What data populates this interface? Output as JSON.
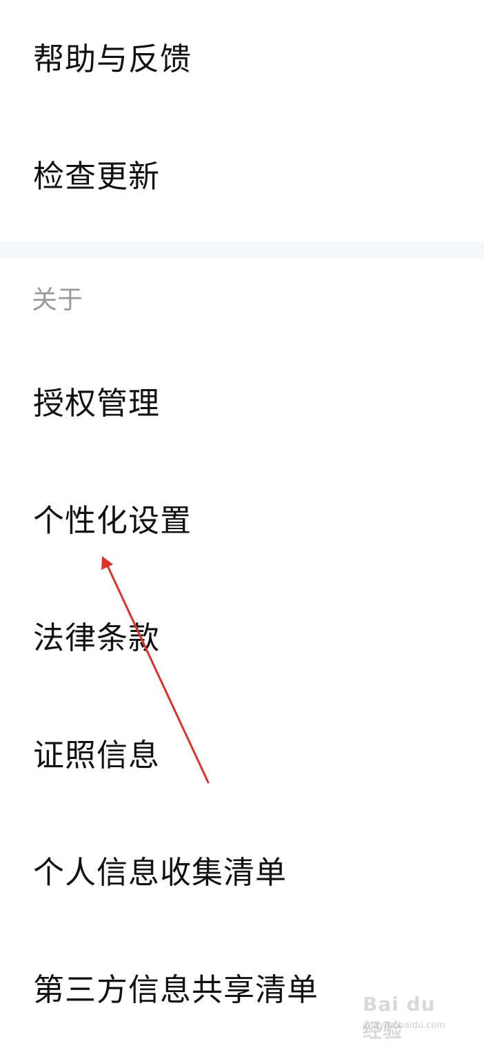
{
  "settings_top": {
    "items": [
      {
        "label": "帮助与反馈"
      },
      {
        "label": "检查更新"
      }
    ]
  },
  "about_section": {
    "title": "关于",
    "items": [
      {
        "label": "授权管理"
      },
      {
        "label": "个性化设置"
      },
      {
        "label": "法律条款"
      },
      {
        "label": "证照信息"
      },
      {
        "label": "个人信息收集清单"
      },
      {
        "label": "第三方信息共享清单"
      }
    ]
  },
  "annotation": {
    "arrow_color": "#e0302a",
    "target": "个性化设置"
  },
  "colors": {
    "background": "#ffffff",
    "divider": "#f6f7fa",
    "item_text": "#111111",
    "section_text": "#9a9a9a"
  },
  "watermark": {
    "brand": "Bai du 经验",
    "url": "jingyan.baidu.com"
  }
}
